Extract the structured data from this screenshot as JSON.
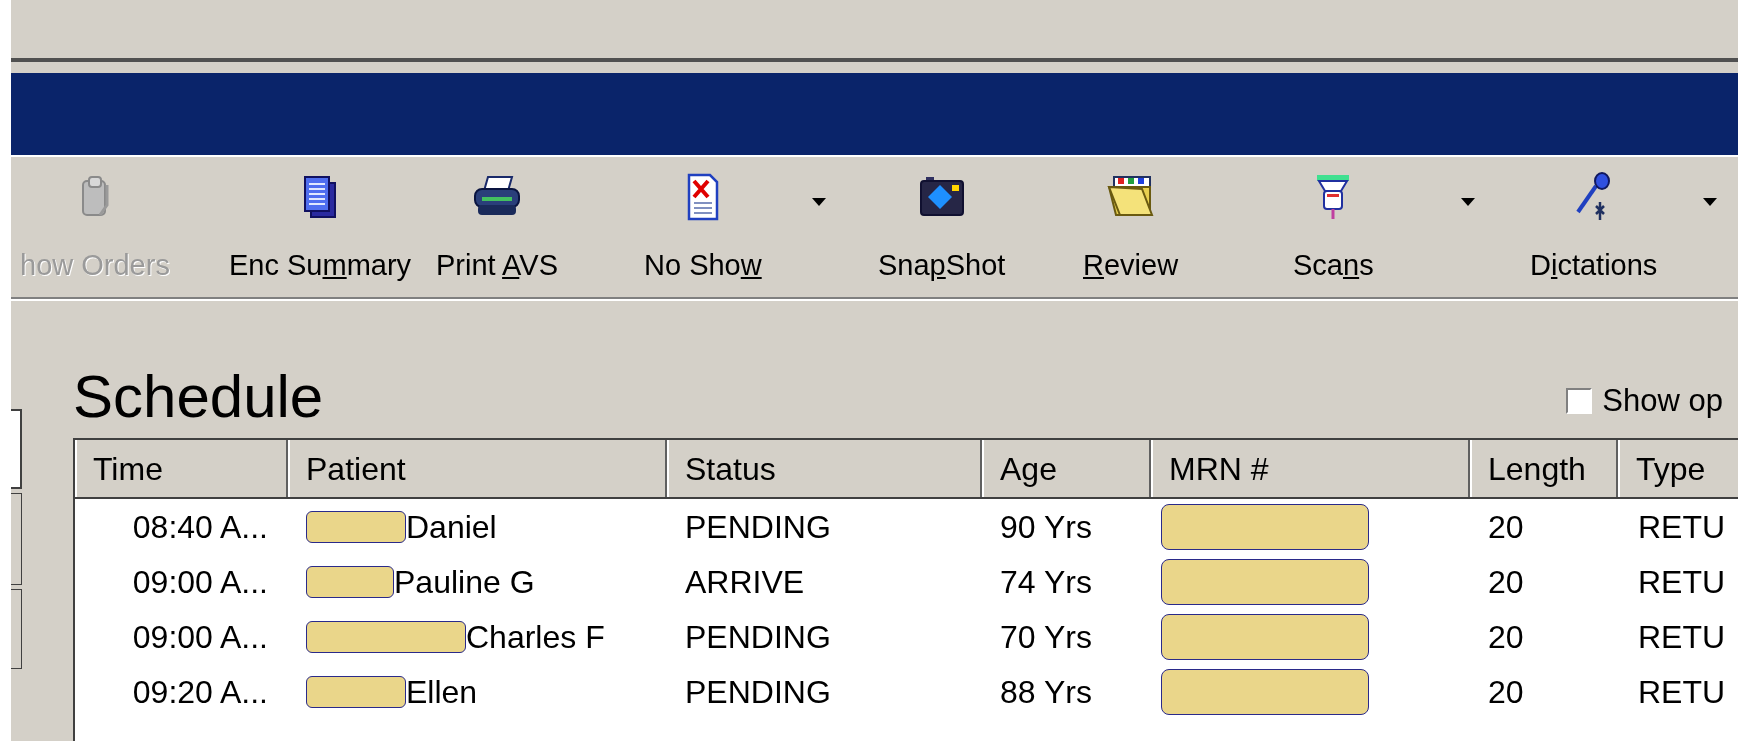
{
  "toolbar": [
    {
      "label": {
        "post": "how Orders"
      },
      "disabled": true,
      "dropdown": false
    },
    {
      "label": {
        "pre": "Enc Su",
        "key": "m",
        "post": "mary"
      },
      "disabled": false,
      "dropdown": false
    },
    {
      "label": {
        "pre": "Print ",
        "key": "A",
        "post": "VS"
      },
      "disabled": false,
      "dropdown": false
    },
    {
      "label": {
        "pre": "No Sho",
        "key": "w"
      },
      "disabled": false,
      "dropdown": true
    },
    {
      "label": {
        "pre": "Sna",
        "key": "p",
        "post": "Shot"
      },
      "disabled": false,
      "dropdown": false
    },
    {
      "label": {
        "key": "R",
        "post": "eview"
      },
      "disabled": false,
      "dropdown": false
    },
    {
      "label": {
        "pre": "Sca",
        "key": "n",
        "post": "s"
      },
      "disabled": false,
      "dropdown": true
    },
    {
      "label": {
        "pre": "D",
        "key": "i",
        "post": "ctations"
      },
      "disabled": false,
      "dropdown": true
    }
  ],
  "schedule": {
    "title": "Schedule",
    "show_option": {
      "label": "Show op",
      "checked": false
    },
    "table": {
      "columns": [
        "Time",
        "Patient",
        "Status",
        "Age",
        "MRN #",
        "Length",
        "Type"
      ],
      "rows": [
        {
          "time": "08:40 A...",
          "patient": "Daniel",
          "patient_redacted": true,
          "status": "PENDING",
          "age": "90 Yrs",
          "mrn_redacted": true,
          "length": "20",
          "type": "RETU"
        },
        {
          "time": "09:00 A...",
          "patient": "Pauline G",
          "patient_redacted": true,
          "status": "ARRIVE",
          "age": "74 Yrs",
          "mrn_redacted": true,
          "length": "20",
          "type": "RETU"
        },
        {
          "time": "09:00 A...",
          "patient": "Charles F",
          "patient_redacted": true,
          "status": "PENDING",
          "age": "70 Yrs",
          "mrn_redacted": true,
          "length": "20",
          "type": "RETU"
        },
        {
          "time": "09:20 A...",
          "patient": "Ellen",
          "patient_redacted": true,
          "status": "PENDING",
          "age": "88 Yrs",
          "mrn_redacted": true,
          "length": "20",
          "type": "RETU"
        }
      ]
    }
  }
}
